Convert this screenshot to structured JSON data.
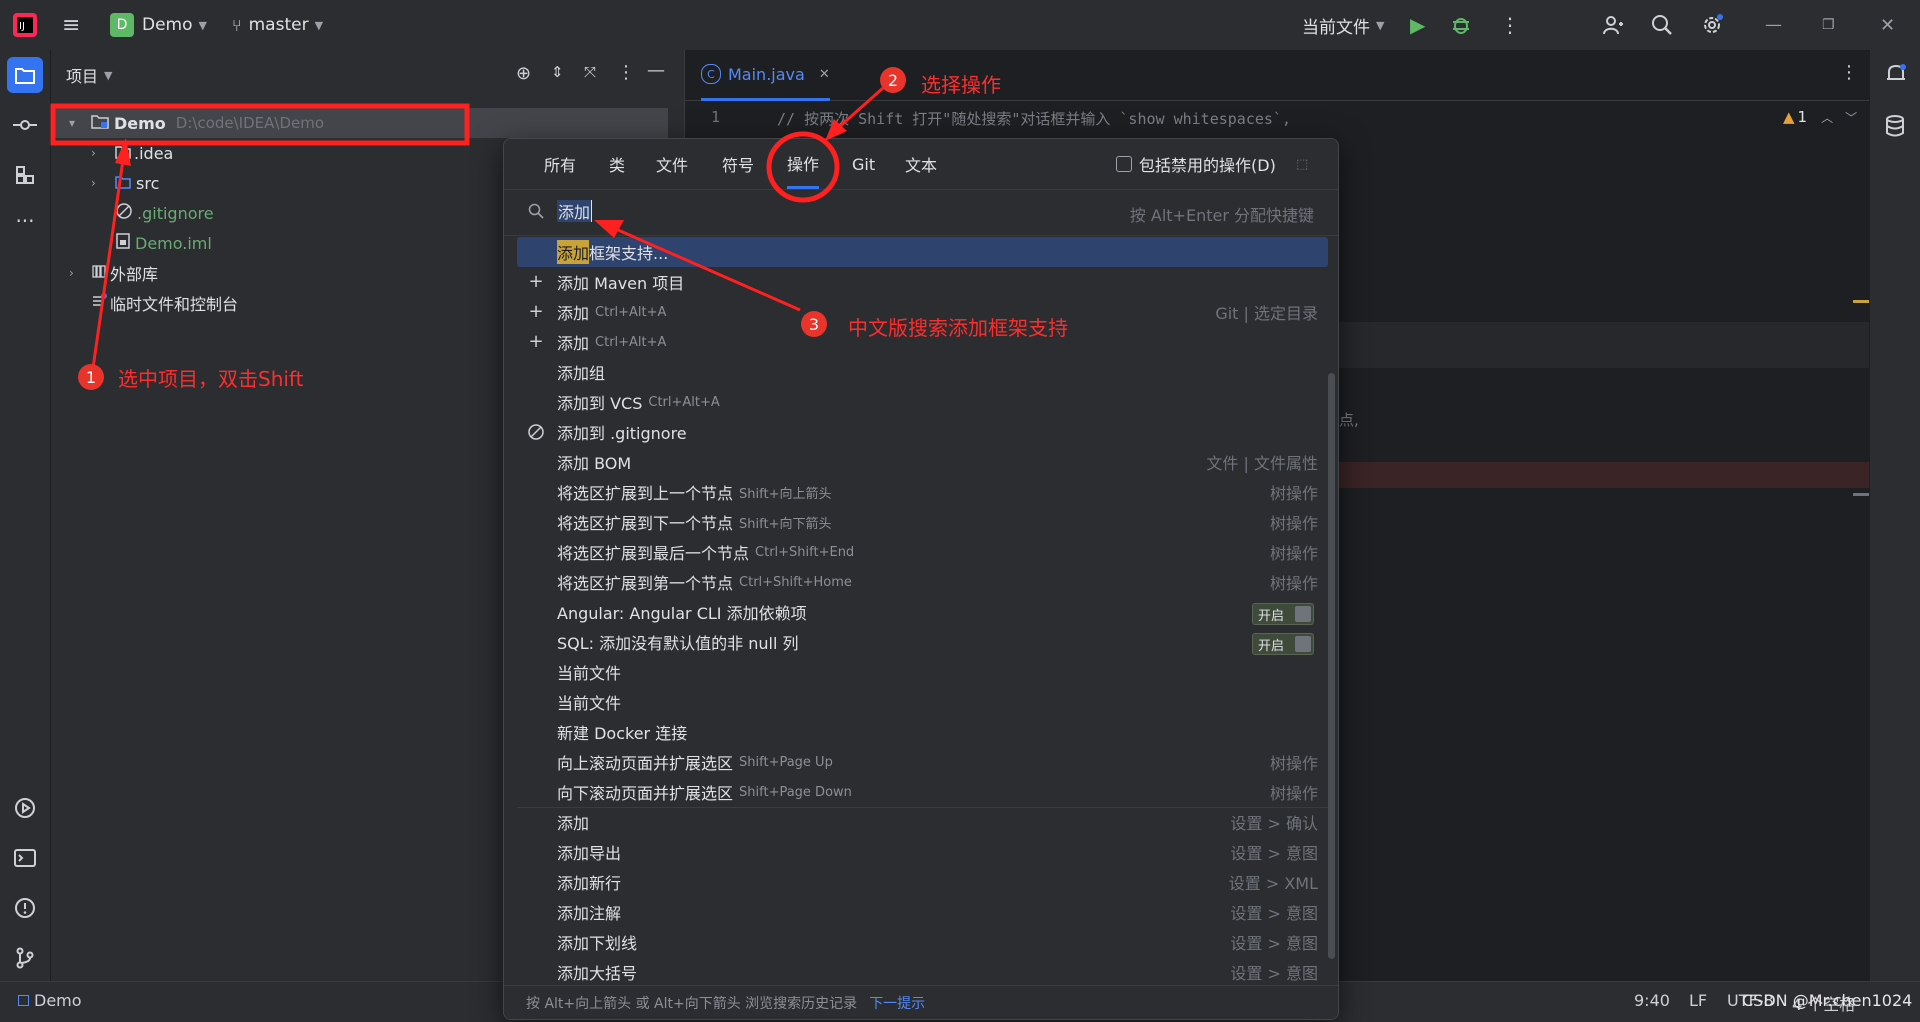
{
  "titlebar": {
    "project_badge": "D",
    "project_name": "Demo",
    "branch": "master",
    "run_config": "当前文件"
  },
  "project_panel": {
    "title": "项目",
    "tree": [
      {
        "name": "Demo",
        "path": "D:\\code\\IDEA\\Demo",
        "level": 0,
        "expanded": true,
        "icon": "project-folder-icon"
      },
      {
        "name": ".idea",
        "level": 1,
        "expanded": false,
        "icon": "folder-icon"
      },
      {
        "name": "src",
        "level": 1,
        "expanded": false,
        "icon": "source-folder-icon"
      },
      {
        "name": ".gitignore",
        "level": 1,
        "icon": "ignore-file-icon"
      },
      {
        "name": "Demo.iml",
        "level": 1,
        "icon": "module-file-icon"
      },
      {
        "name": "外部库",
        "level": 0,
        "expanded": false,
        "icon": "library-icon"
      },
      {
        "name": "临时文件和控制台",
        "level": 0,
        "icon": "scratch-icon"
      }
    ]
  },
  "editor": {
    "tab_label": "Main.java",
    "line_number": "1",
    "code_line": "// 按两次 Shift 打开\"随处搜索\"对话框并输入 `show whitespaces`,",
    "right_fragment": "点,",
    "warning_count": "1"
  },
  "popup": {
    "tabs": [
      "所有",
      "类",
      "文件",
      "符号",
      "操作",
      "Git",
      "文本"
    ],
    "active_tab": 4,
    "include_disabled_label": "包括禁用的操作(D)",
    "search_value": "添加",
    "search_hint": "按 Alt+Enter 分配快捷键",
    "results": [
      {
        "icon": "",
        "label_highlight": "添加",
        "label": "框架支持...",
        "shortcut": "",
        "right": "",
        "toggle": "",
        "selected": true
      },
      {
        "icon": "plus-icon",
        "label": "添加 Maven 项目",
        "shortcut": "",
        "right": "",
        "toggle": ""
      },
      {
        "icon": "plus-icon",
        "label": "添加",
        "shortcut": "Ctrl+Alt+A",
        "right": "Git | 选定目录",
        "toggle": ""
      },
      {
        "icon": "plus-icon",
        "label": "添加",
        "shortcut": "Ctrl+Alt+A",
        "right": "",
        "toggle": ""
      },
      {
        "icon": "",
        "label": "添加组",
        "shortcut": "",
        "right": "",
        "toggle": ""
      },
      {
        "icon": "",
        "label": "添加到 VCS",
        "shortcut": "Ctrl+Alt+A",
        "right": "",
        "toggle": ""
      },
      {
        "icon": "ignore-icon",
        "label": "添加到 .gitignore",
        "shortcut": "",
        "right": "",
        "toggle": ""
      },
      {
        "icon": "",
        "label": "添加 BOM",
        "shortcut": "",
        "right": "文件 | 文件属性",
        "toggle": ""
      },
      {
        "icon": "",
        "label": "将选区扩展到上一个节点",
        "shortcut": "Shift+向上箭头",
        "right": "树操作",
        "toggle": ""
      },
      {
        "icon": "",
        "label": "将选区扩展到下一个节点",
        "shortcut": "Shift+向下箭头",
        "right": "树操作",
        "toggle": ""
      },
      {
        "icon": "",
        "label": "将选区扩展到最后一个节点",
        "shortcut": "Ctrl+Shift+End",
        "right": "树操作",
        "toggle": ""
      },
      {
        "icon": "",
        "label": "将选区扩展到第一个节点",
        "shortcut": "Ctrl+Shift+Home",
        "right": "树操作",
        "toggle": ""
      },
      {
        "icon": "",
        "label": "Angular: Angular CLI 添加依赖项",
        "shortcut": "",
        "right": "",
        "toggle": "开启"
      },
      {
        "icon": "",
        "label": "SQL: 添加没有默认值的非 null 列",
        "shortcut": "",
        "right": "",
        "toggle": "开启"
      },
      {
        "icon": "",
        "label": "当前文件",
        "shortcut": "",
        "right": "",
        "toggle": ""
      },
      {
        "icon": "",
        "label": "当前文件",
        "shortcut": "",
        "right": "",
        "toggle": ""
      },
      {
        "icon": "",
        "label": "新建 Docker 连接",
        "shortcut": "",
        "right": "",
        "toggle": ""
      },
      {
        "icon": "",
        "label": "向上滚动页面并扩展选区",
        "shortcut": "Shift+Page Up",
        "right": "树操作",
        "toggle": ""
      },
      {
        "icon": "",
        "label": "向下滚动页面并扩展选区",
        "shortcut": "Shift+Page Down",
        "right": "树操作",
        "toggle": ""
      },
      {
        "icon": "",
        "label": "添加",
        "shortcut": "",
        "right": "设置 > 确认",
        "toggle": ""
      },
      {
        "icon": "",
        "label": "添加导出",
        "shortcut": "",
        "right": "设置 > 意图",
        "toggle": ""
      },
      {
        "icon": "",
        "label": "添加新行",
        "shortcut": "",
        "right": "设置 > XML",
        "toggle": ""
      },
      {
        "icon": "",
        "label": "添加注解",
        "shortcut": "",
        "right": "设置 > 意图",
        "toggle": ""
      },
      {
        "icon": "",
        "label": "添加下划线",
        "shortcut": "",
        "right": "设置 > 意图",
        "toggle": ""
      },
      {
        "icon": "",
        "label": "添加大括号",
        "shortcut": "",
        "right": "设置 > 意图",
        "toggle": ""
      }
    ],
    "footer_hint": "按 Alt+向上箭头 或 Alt+向下箭头 浏览搜索历史记录",
    "footer_link": "下一提示"
  },
  "statusbar": {
    "project": "Demo",
    "position": "9:40",
    "line_sep": "LF",
    "encoding": "UTF-8",
    "indent": "4 个空格"
  },
  "annotations": [
    {
      "num": "1",
      "text": "选中项目，双击Shift"
    },
    {
      "num": "2",
      "text": "选择操作"
    },
    {
      "num": "3",
      "text": "中文版搜索添加框架支持"
    }
  ],
  "watermark": "CSDN @Mr.chen1024",
  "colors": {
    "accent": "#3574f0",
    "selection": "#2e436e",
    "annotation_red": "#ff2d2d",
    "highlight_match": "#c9a33a",
    "green_file": "#6aab73"
  }
}
